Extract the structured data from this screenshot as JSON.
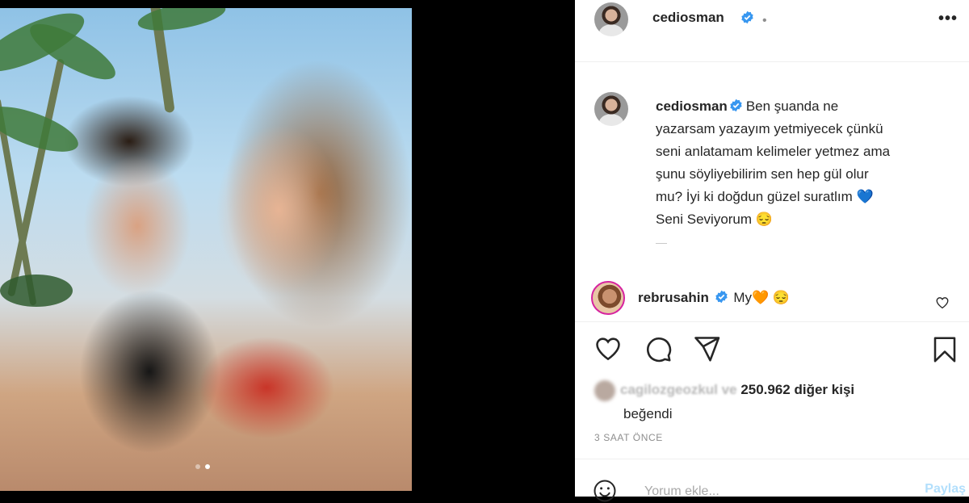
{
  "post": {
    "author": "cediosman",
    "header_dot": "•",
    "more_label": "•••",
    "caption": "Ben şuanda ne yazarsam yazayım yetmiyecek çünkü seni anlatamam kelimeler yetmez ama şunu söyliyebilirim sen hep gül olur mu? İyi ki doğdun güzel suratlım 💙 Seni Seviyorum 😔",
    "caption_more": "—",
    "comment": {
      "user": "rebrusahin",
      "text": "My🧡 😔"
    },
    "likes": {
      "blurred_user": "cagilozgeozkul",
      "connector": "ve",
      "count_text": "250.962 diğer kişi",
      "suffix": "beğendi"
    },
    "time": "3 SAAT ÖNCE",
    "comment_box": {
      "placeholder": "Yorum ekle...",
      "post_label": "Paylaş"
    }
  },
  "carousel": {
    "count": 2,
    "active": 1
  },
  "icons": [
    "heart-icon",
    "comment-icon",
    "share-icon",
    "bookmark-icon",
    "verified-badge-icon",
    "smiley-icon"
  ],
  "colors": {
    "verified": "#3897f0",
    "text": "#262626",
    "muted": "#8e8e8e",
    "post_disabled": "#b2dffc"
  }
}
